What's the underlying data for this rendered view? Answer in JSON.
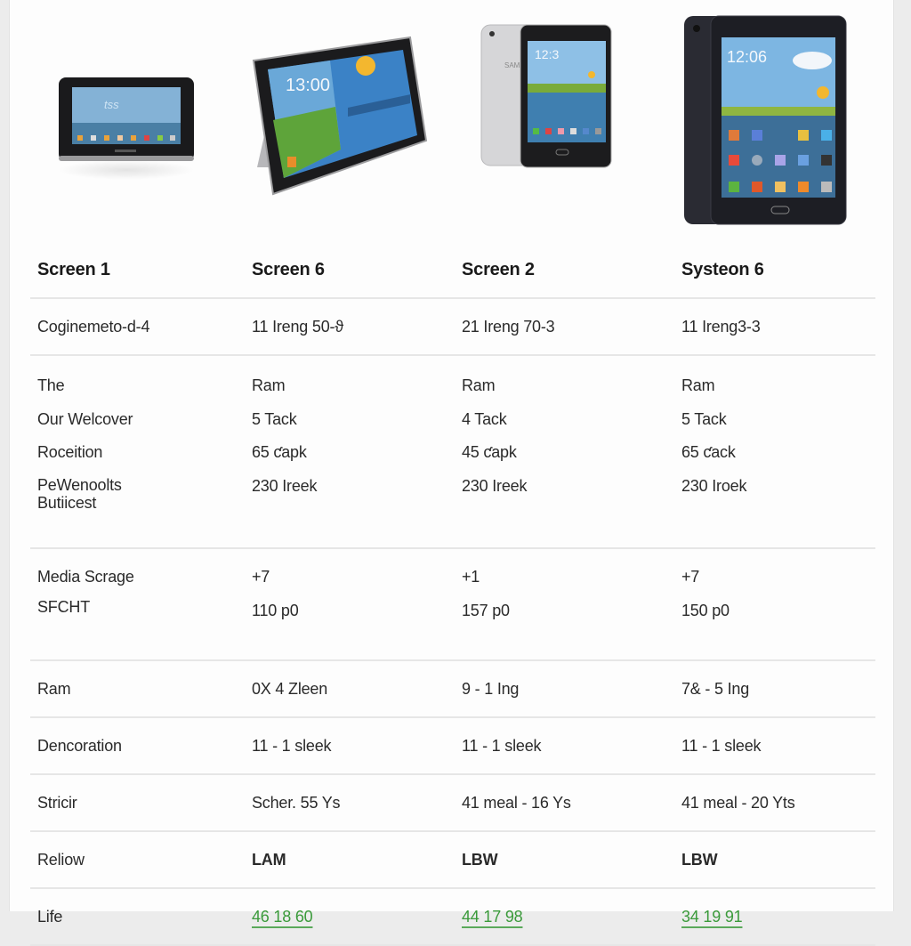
{
  "devices": [
    {
      "name": "tablet-1",
      "screen_time": ""
    },
    {
      "name": "tablet-2",
      "screen_time": "13:00"
    },
    {
      "name": "tablet-3",
      "screen_time": "12:3",
      "brand_side": "SAMS"
    },
    {
      "name": "tablet-4",
      "screen_time": "12:06"
    }
  ],
  "table": {
    "headers": [
      "Screen 1",
      "Screen 6",
      "Screen 2",
      "Systeon 6"
    ],
    "rows": [
      {
        "label": [
          "Coginemeto-d-4"
        ],
        "values": [
          [
            "11 Ireng 50-ϑ"
          ],
          [
            "21 Ireng 70-3"
          ],
          [
            "11 Ireng3-3"
          ]
        ]
      },
      {
        "label": [
          "The",
          "Our Welcover",
          "Roceition",
          "PeWenoolts Butiicest"
        ],
        "values": [
          [
            "Ram",
            "5 Tack",
            "65 ƈapk",
            "230 Ireek"
          ],
          [
            "Ram",
            "4 Tack",
            "45 ƈapk",
            "230 Ireek"
          ],
          [
            "Ram",
            "5 Tack",
            "65 ƈack",
            "230 Iroek"
          ]
        ]
      },
      {
        "label": [
          "Media Scrage",
          "SFCHT"
        ],
        "values": [
          [
            "+7",
            "110 p0"
          ],
          [
            "+1",
            "157 p0"
          ],
          [
            "+7",
            "150 p0"
          ]
        ]
      },
      {
        "label": [
          "Ram"
        ],
        "values": [
          [
            "0X 4 Zleen"
          ],
          [
            "9 - 1 Ing"
          ],
          [
            "7& - 5 Ing"
          ]
        ]
      },
      {
        "label": [
          "Dencoration"
        ],
        "values": [
          [
            "11 - 1 sleek"
          ],
          [
            "11 - 1 sleek"
          ],
          [
            "11 - 1 sleek"
          ]
        ]
      },
      {
        "label": [
          "Stricir"
        ],
        "values": [
          [
            "Scher. 55 Ys"
          ],
          [
            "41 meal - 16 Ys"
          ],
          [
            "41 meal - 20 Yts"
          ]
        ]
      },
      {
        "label": [
          "Reliow"
        ],
        "values": [
          [
            "LAM"
          ],
          [
            "LBW"
          ],
          [
            "LBW"
          ]
        ]
      },
      {
        "label": [
          "Life"
        ],
        "values": [
          [
            "46 18 60"
          ],
          [
            "44 17 98"
          ],
          [
            "34 19 91"
          ]
        ]
      }
    ]
  },
  "colors": {
    "rating": "#e6a032",
    "life": "#3a9a3a",
    "divider": "#e6e6e6"
  }
}
